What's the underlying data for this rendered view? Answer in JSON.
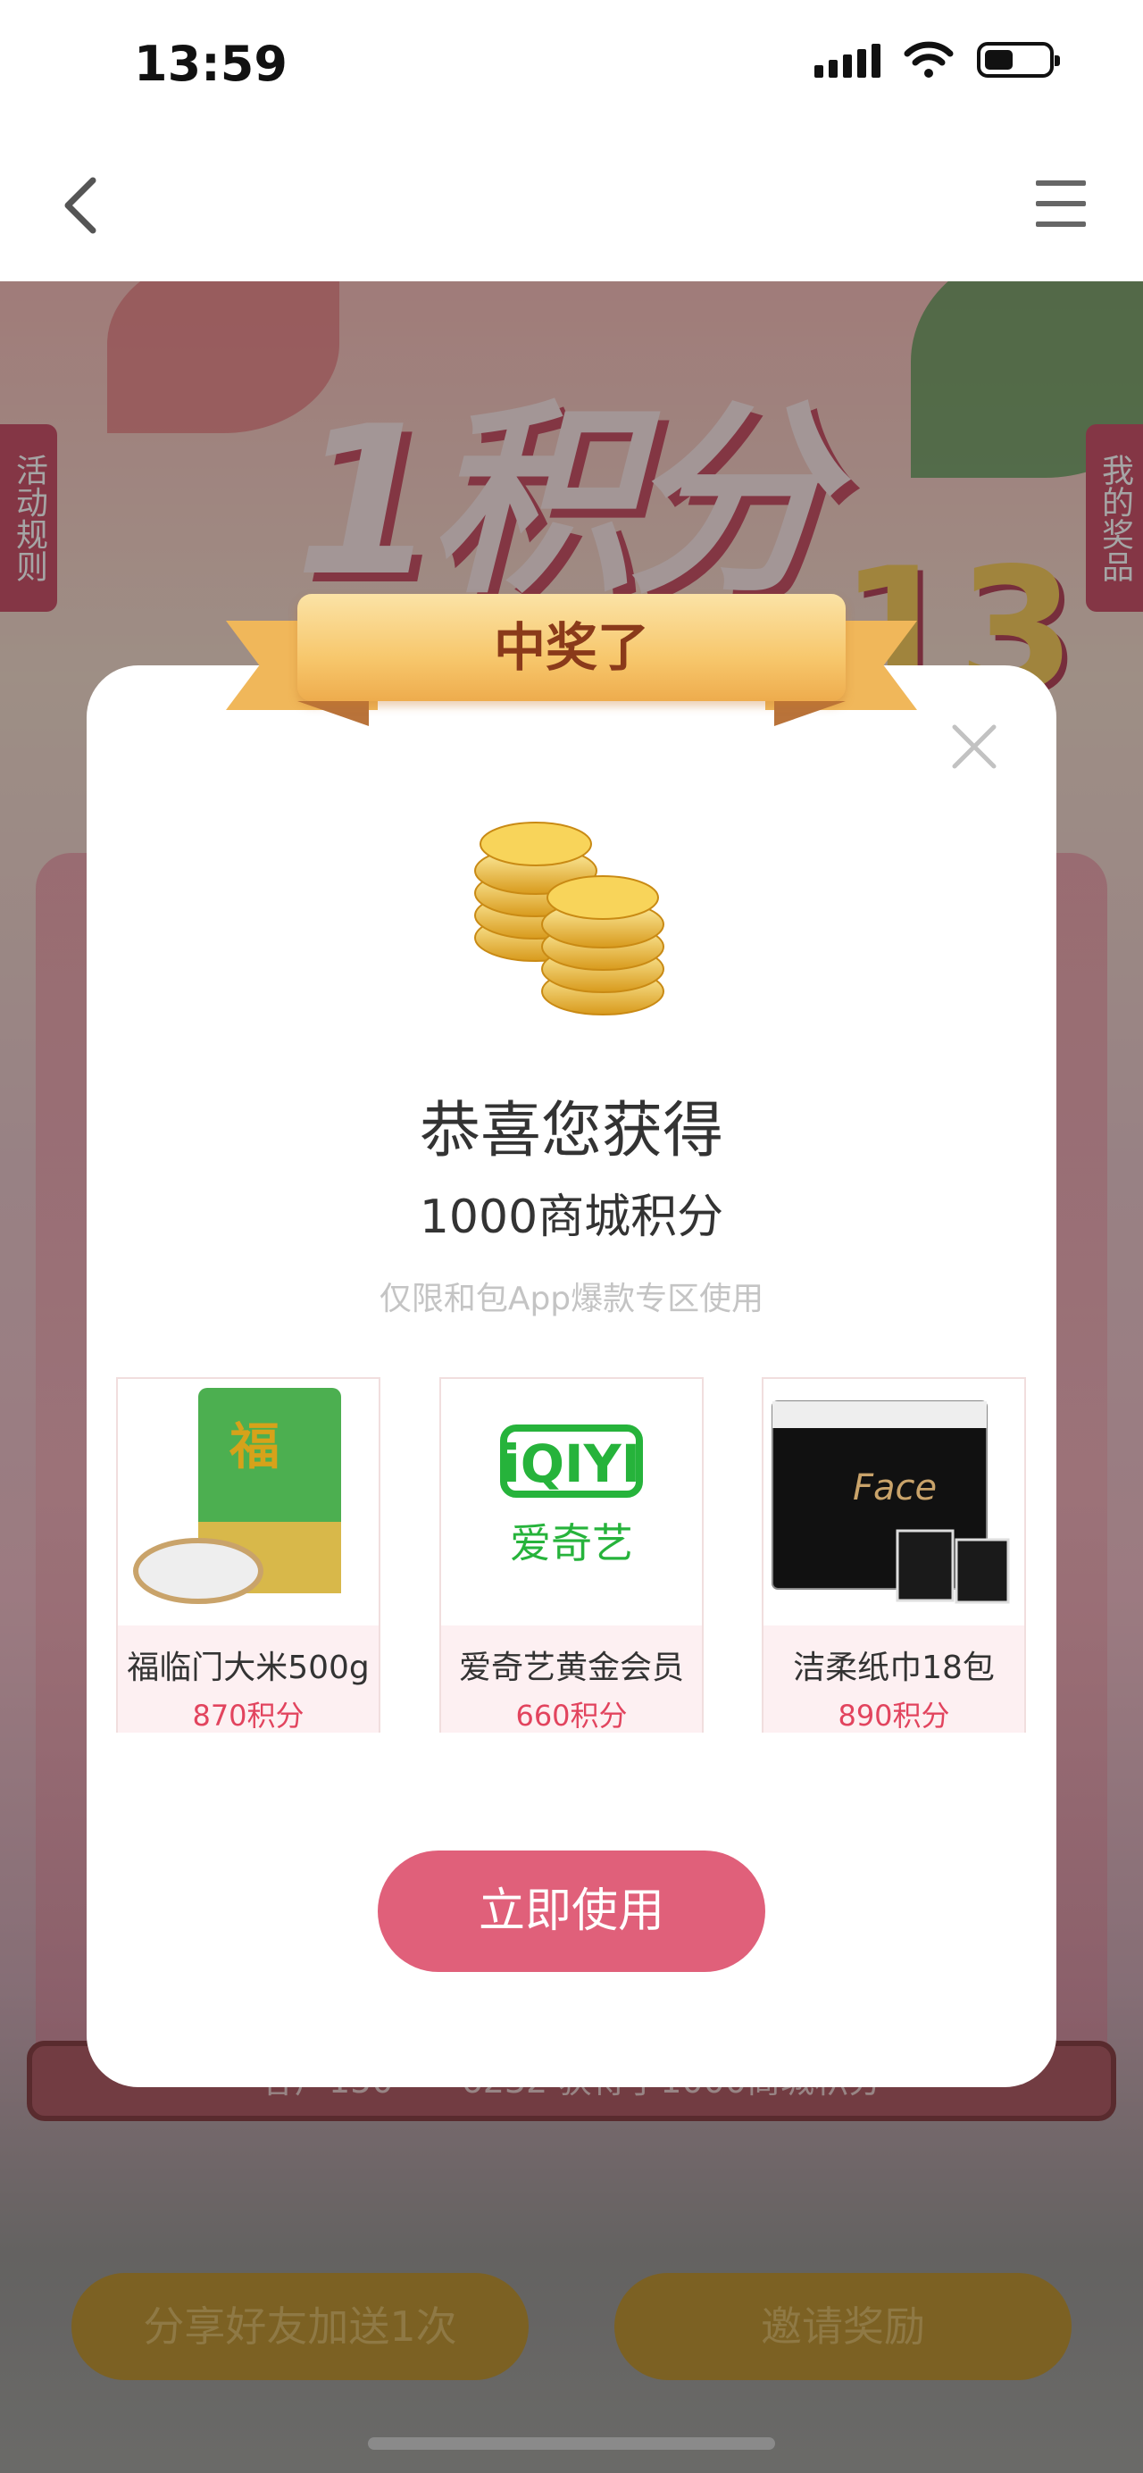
{
  "status_bar": {
    "time": "13:59",
    "battery_level": 0.45
  },
  "nav": {
    "back_icon": "chevron-left-icon",
    "menu_icon": "menu-icon"
  },
  "background": {
    "banner_title": "1积分",
    "banner_number": "13",
    "rules_tab": "活动规则",
    "my_prizes_tab": "我的奖品",
    "winner_ticker": "客户150****6232 获得了1000商城积分",
    "share_button": "分享好友加送1次",
    "invite_button": "邀请奖励"
  },
  "modal": {
    "ribbon_title": "中奖了",
    "close_icon": "close-icon",
    "coins_icon": "gold-coins-icon",
    "congrats": "恭喜您获得",
    "reward": "1000商城积分",
    "note": "仅限和包App爆款专区使用",
    "products": [
      {
        "name": "福临门大米500g",
        "points": "870",
        "unit": "积分",
        "image": "rice-bag-image"
      },
      {
        "name": "爱奇艺黄金会员",
        "points": "660",
        "unit": "积分",
        "image": "iqiyi-logo-image"
      },
      {
        "name": "洁柔纸巾18包",
        "points": "890",
        "unit": "积分",
        "image": "tissue-pack-image"
      }
    ],
    "use_button": "立即使用"
  },
  "colors": {
    "accent": "#e0607a",
    "price": "#e2445e",
    "ribbon": "#f7c76c"
  }
}
